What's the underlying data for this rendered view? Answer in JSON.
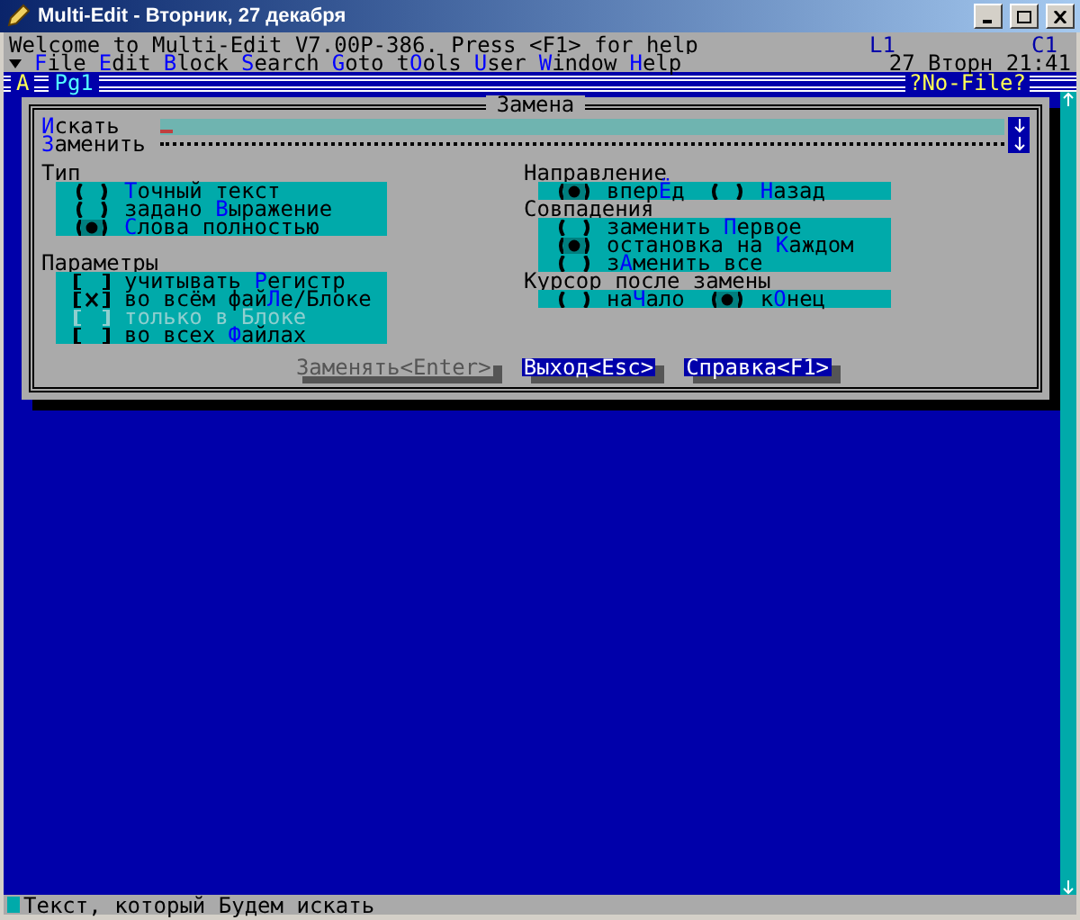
{
  "window": {
    "title": "Multi-Edit - Вторник, 27 декабря"
  },
  "top_line": {
    "welcome": "Welcome to Multi-Edit V7.00P-386. Press <F1> for help",
    "line": "L1",
    "column": "C1"
  },
  "menu": [
    {
      "label": "**F**ile"
    },
    {
      "label": "**E**dit"
    },
    {
      "label": "**B**lock"
    },
    {
      "label": "**S**earch"
    },
    {
      "label": "**G**oto"
    },
    {
      "label": "t**O**ols"
    },
    {
      "label": "**U**ser"
    },
    {
      "label": "**W**indow"
    },
    {
      "label": "**H**elp"
    }
  ],
  "clock": "27 Вторн 21:41",
  "editor": {
    "window_letter": "A",
    "page": "Pg1",
    "file": "?No-File?"
  },
  "dialog": {
    "title": "Замена",
    "search": {
      "label": "**И**скать"
    },
    "replace": {
      "label": "**З**аменить"
    },
    "type": {
      "label": "Тип",
      "options": [
        {
          "label": "**Т**очный текст",
          "selected": false
        },
        {
          "label": "задано **В**ыражение",
          "selected": false
        },
        {
          "label": "**С**лова полностью",
          "selected": true
        }
      ]
    },
    "parameters": {
      "label": "Параметры",
      "options": [
        {
          "label": "учитывать **Р**егистр",
          "checked": false,
          "disabled": false
        },
        {
          "label": "во всём фай**Л**е/Блоке",
          "checked": true,
          "disabled": false
        },
        {
          "label": "только в Блоке",
          "checked": false,
          "disabled": true
        },
        {
          "label": "во всех **Ф**айлах",
          "checked": false,
          "disabled": false
        }
      ]
    },
    "direction": {
      "label": "Направление",
      "options": [
        {
          "label": "впер**Ё**д",
          "selected": true
        },
        {
          "label": "**Н**азад",
          "selected": false
        }
      ]
    },
    "matches": {
      "label": "Совпадения",
      "options": [
        {
          "label": "заменить **П**ервое",
          "selected": false
        },
        {
          "label": "остановка на **К**аждом",
          "selected": true
        },
        {
          "label": "з**А**менить все",
          "selected": false
        }
      ]
    },
    "cursor": {
      "label": "Курсор после замены",
      "options": [
        {
          "label": "на**Ч**ало",
          "selected": false
        },
        {
          "label": "к**О**нец",
          "selected": true
        }
      ]
    },
    "buttons": [
      {
        "label": "Заменять<Enter>",
        "disabled": true
      },
      {
        "label": "Выход<Esc>",
        "disabled": false
      },
      {
        "label": "Справка<F1>",
        "disabled": false
      }
    ]
  },
  "status_bar": "Текст, который Будем искать"
}
